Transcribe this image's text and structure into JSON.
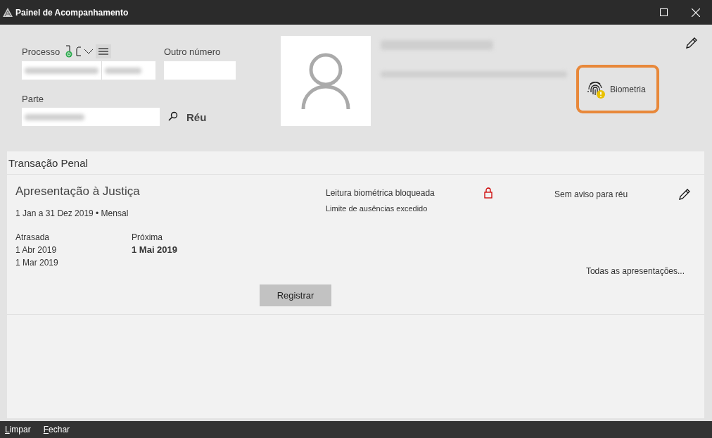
{
  "window": {
    "title": "Painel de Acompanhamento"
  },
  "form": {
    "processo_label": "Processo",
    "outro_numero_label": "Outro número",
    "parte_label": "Parte",
    "role": "Réu"
  },
  "profile": {
    "biometria_label": "Biometria",
    "biometria_warning": true,
    "highlighted": true
  },
  "section": {
    "title": "Transação Penal"
  },
  "card": {
    "title": "Apresentação à Justiça",
    "period": "1 Jan a 31 Dez 2019 • Mensal",
    "overdue_label": "Atrasada",
    "overdue_dates": [
      "1 Abr 2019",
      "1 Mar 2019"
    ],
    "next_label": "Próxima",
    "next_date": "1 Mai 2019",
    "status": "Leitura biométrica bloqueada",
    "status_detail": "Limite de ausências excedido",
    "locked": true,
    "notice": "Sem aviso para réu",
    "all_link": "Todas as apresentações...",
    "register_button": "Registrar"
  },
  "footer": {
    "buttons": [
      "Limpar",
      "Fechar"
    ]
  }
}
